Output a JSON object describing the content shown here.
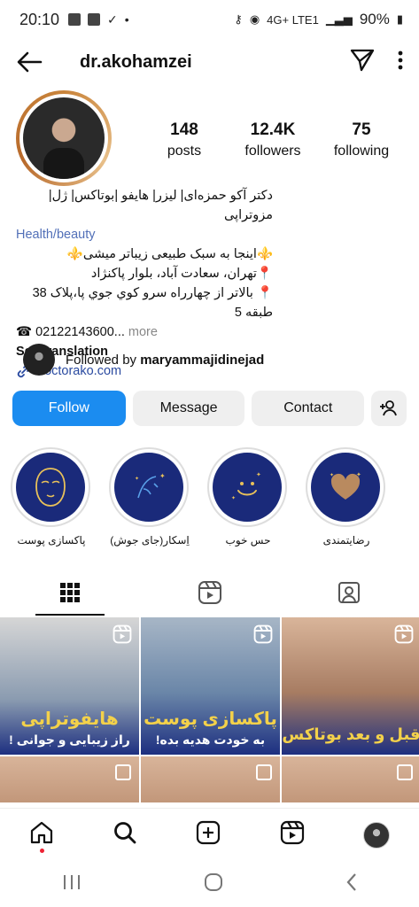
{
  "status_bar": {
    "time": "20:10",
    "battery": "90%",
    "network": "4G+ LTE1"
  },
  "header": {
    "username": "dr.akohamzei"
  },
  "profile": {
    "stats": [
      {
        "num": "148",
        "label": "posts"
      },
      {
        "num": "12.4K",
        "label": "followers"
      },
      {
        "num": "75",
        "label": "following"
      }
    ]
  },
  "bio": {
    "name_line": "دکتر آکو حمزه‌ای| لیزر| هایفو |بوتاکس| ژل| مزوتراپی",
    "category": "Health/beauty",
    "line1": "⚜️اینجا به سبک طبیعی زیباتر میشی⚜️",
    "line2": "📍تهران، سعادت آباد، بلوار پاکنژاد",
    "line3": "📍 بالاتر از چهارراه سرو کوي جوي پا،پلاک 38 طبقه 5",
    "phone": "☎ 02122143600...",
    "more": "more",
    "see_translation": "See translation",
    "link": "doctorako.com"
  },
  "followed_by": {
    "prefix": "Followed by",
    "user": "maryammajidinejad"
  },
  "buttons": {
    "follow": "Follow",
    "message": "Message",
    "contact": "Contact"
  },
  "highlights": [
    {
      "label": "پاکسازی پوست",
      "icon": "face-mask-icon"
    },
    {
      "label": "اِسکار(جای جوش)",
      "icon": "face-scar-icon"
    },
    {
      "label": "حس خوب",
      "icon": "smiley-icon"
    },
    {
      "label": "رضایتمندی",
      "icon": "heart-icon"
    }
  ],
  "posts": [
    {
      "title": "هایفوتراپی",
      "subtitle": "راز زیبایی و جوانی !"
    },
    {
      "title": "پاکسازی پوست",
      "subtitle": "به خودت هدیه بده!"
    },
    {
      "title": "قبل و بعد بوتاکس",
      "subtitle": ""
    },
    {
      "title": "",
      "subtitle": ""
    },
    {
      "title": "",
      "subtitle": ""
    },
    {
      "title": "",
      "subtitle": ""
    }
  ],
  "colors": {
    "follow_button": "#1b8cf0",
    "highlight_bg": "#1a2a7a",
    "link": "#2a4aa0"
  }
}
